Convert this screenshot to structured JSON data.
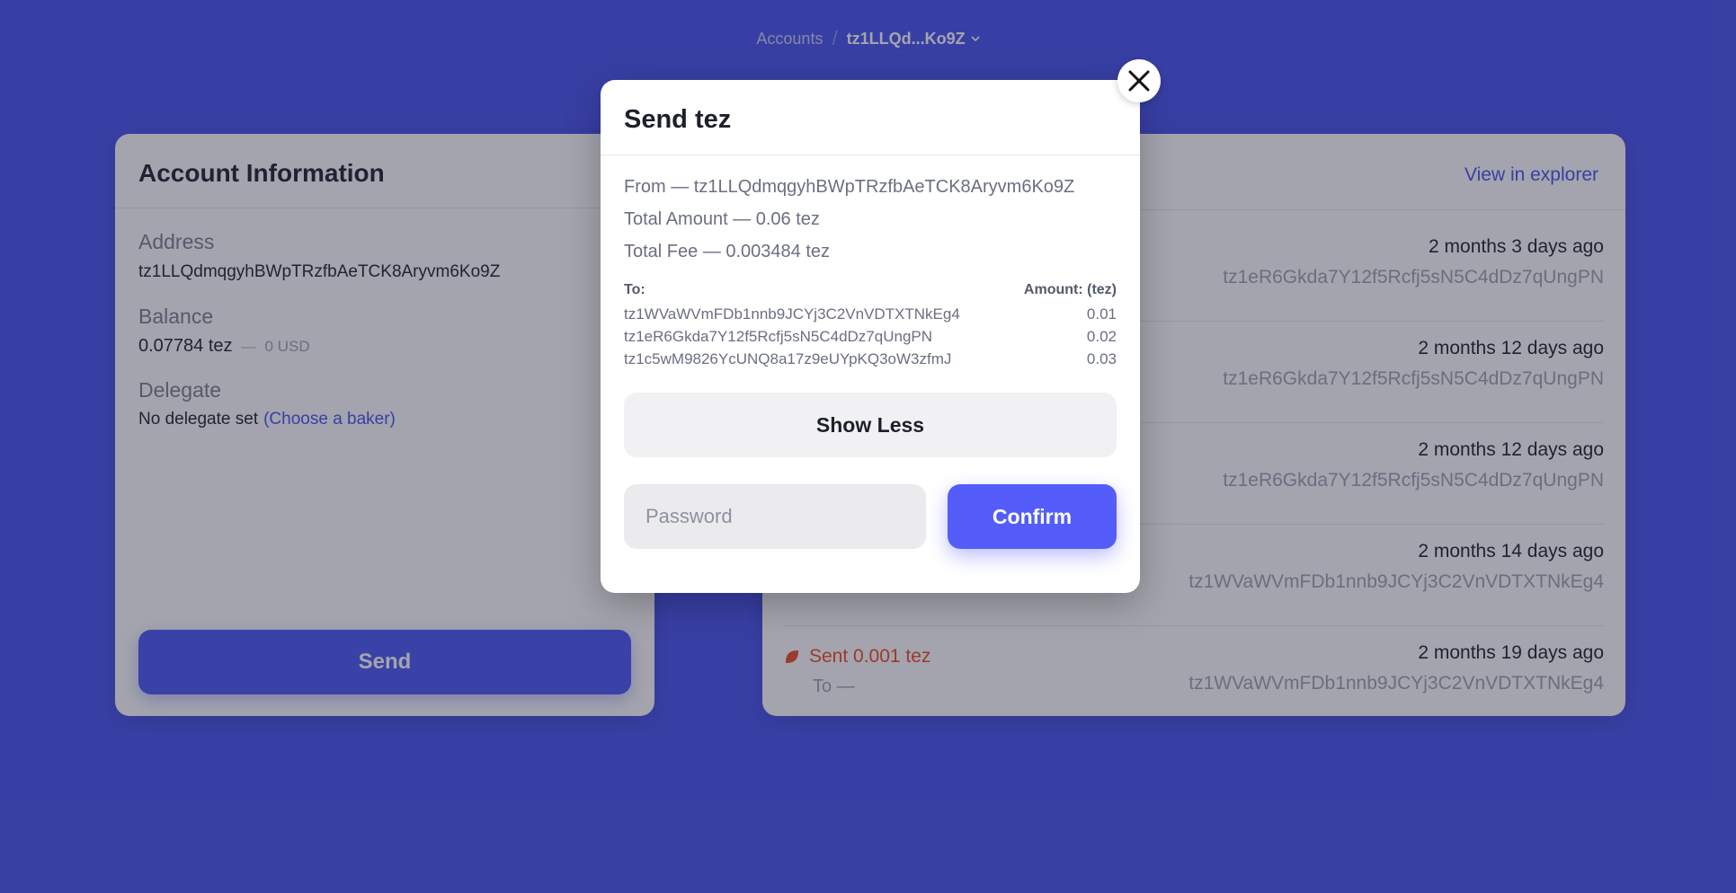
{
  "breadcrumb": {
    "root": "Accounts",
    "separator": "/",
    "current": "tz1LLQd...Ko9Z"
  },
  "account_card": {
    "title": "Account Information",
    "address_label": "Address",
    "address_value": "tz1LLQdmqgyhBWpTRzfbAeTCK8Aryvm6Ko9Z",
    "balance_label": "Balance",
    "balance_tez": "0.07784 tez",
    "balance_dash": "—",
    "balance_usd": "0 USD",
    "delegate_label": "Delegate",
    "delegate_text": "No delegate set",
    "delegate_link": "(Choose a baker)",
    "send_label": "Send"
  },
  "history_card": {
    "explorer_link": "View in explorer",
    "transactions": [
      {
        "time": "2 months 3 days ago",
        "address": "tz1eR6Gkda7Y12f5Rcfj5sN5C4dDz7qUngPN"
      },
      {
        "time": "2 months 12 days ago",
        "address": "tz1eR6Gkda7Y12f5Rcfj5sN5C4dDz7qUngPN"
      },
      {
        "time": "2 months 12 days ago",
        "address": "tz1eR6Gkda7Y12f5Rcfj5sN5C4dDz7qUngPN"
      },
      {
        "time": "2 months 14 days ago",
        "address": "tz1WVaWVmFDb1nnb9JCYj3C2VnVDTXTNkEg4"
      },
      {
        "time": "2 months 19 days ago",
        "address": "tz1WVaWVmFDb1nnb9JCYj3C2VnVDTXTNkEg4",
        "kind": "Sent 0.001 tez",
        "direction": "To —"
      }
    ]
  },
  "modal": {
    "title": "Send tez",
    "from_line": "From — tz1LLQdmqgyhBWpTRzfbAeTCK8Aryvm6Ko9Z",
    "total_amount_line": "Total Amount — 0.06 tez",
    "total_fee_line": "Total Fee — 0.003484 tez",
    "table_header_to": "To:",
    "table_header_amount": "Amount: (tez)",
    "recipients": [
      {
        "address": "tz1WVaWVmFDb1nnb9JCYj3C2VnVDTXTNkEg4",
        "amount": "0.01"
      },
      {
        "address": "tz1eR6Gkda7Y12f5Rcfj5sN5C4dDz7qUngPN",
        "amount": "0.02"
      },
      {
        "address": "tz1c5wM9826YcUNQ8a17z9eUYpKQ3oW3zfmJ",
        "amount": "0.03"
      }
    ],
    "show_less_label": "Show Less",
    "password_placeholder": "Password",
    "confirm_label": "Confirm"
  },
  "icons": {
    "close": "close-icon",
    "copy": "copy-icon",
    "chevron": "chevron-down-icon",
    "sent": "sent-icon"
  },
  "colors": {
    "background": "#4852f0",
    "accent": "#545df9",
    "link": "#4852f0",
    "sent": "#f04a20"
  }
}
